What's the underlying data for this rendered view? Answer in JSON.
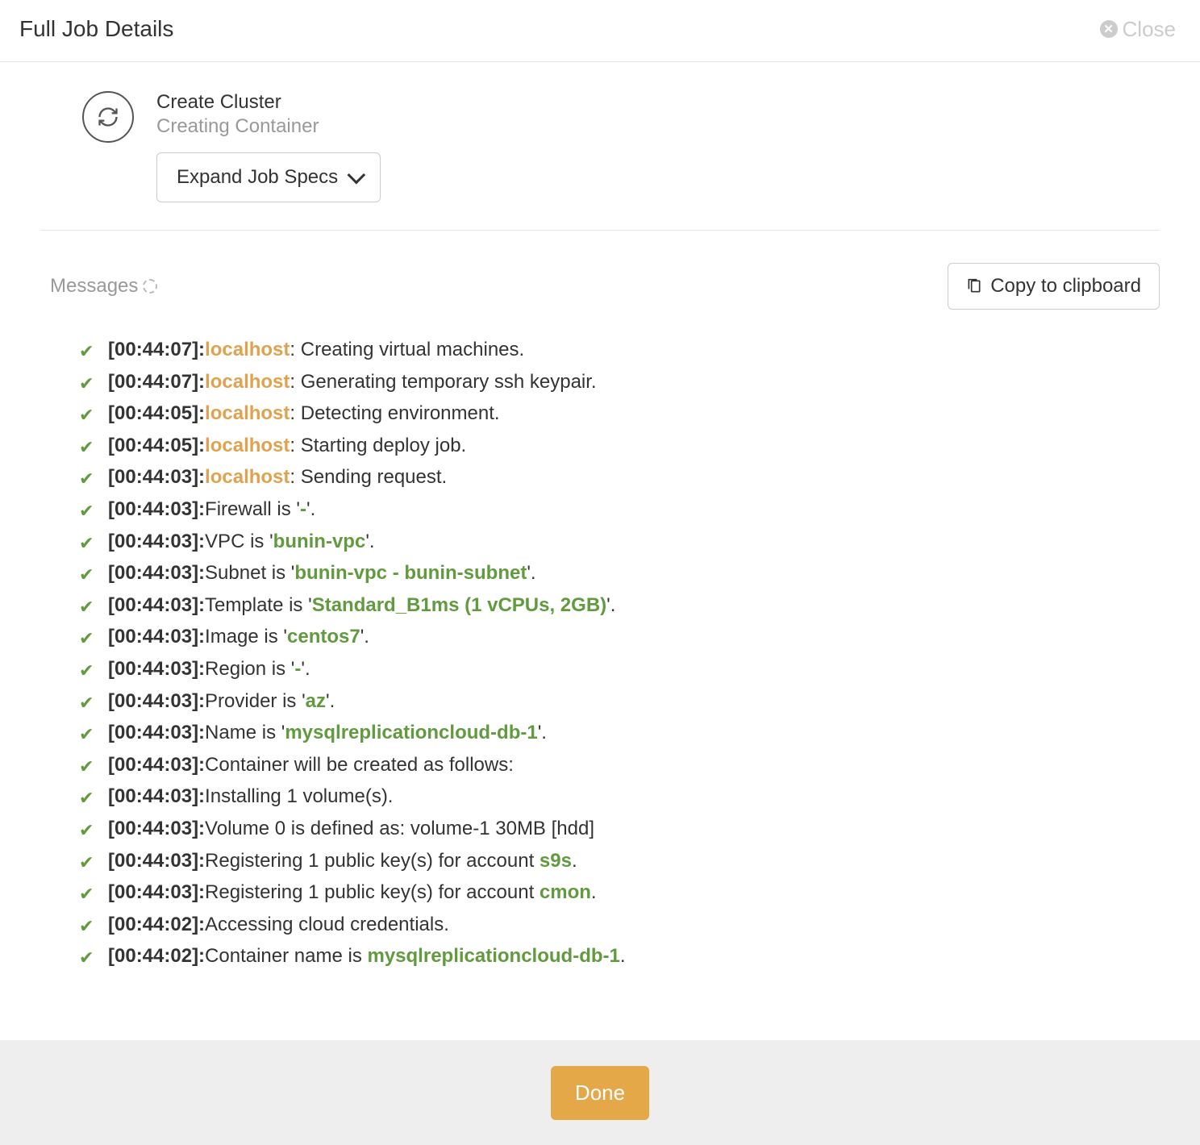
{
  "header": {
    "title": "Full Job Details",
    "close_label": "Close"
  },
  "job": {
    "name": "Create Cluster",
    "status": "Creating Container",
    "expand_label": "Expand Job Specs"
  },
  "messages_section": {
    "label": "Messages",
    "copy_label": "Copy to clipboard"
  },
  "footer": {
    "done_label": "Done"
  },
  "logs": [
    {
      "ts": "[00:44:07]:",
      "host": "localhost",
      "parts": [
        {
          "t": "plain",
          "v": ": Creating virtual machines."
        }
      ]
    },
    {
      "ts": "[00:44:07]:",
      "host": "localhost",
      "parts": [
        {
          "t": "plain",
          "v": ": Generating temporary ssh keypair."
        }
      ]
    },
    {
      "ts": "[00:44:05]:",
      "host": "localhost",
      "parts": [
        {
          "t": "plain",
          "v": ": Detecting environment."
        }
      ]
    },
    {
      "ts": "[00:44:05]:",
      "host": "localhost",
      "parts": [
        {
          "t": "plain",
          "v": ": Starting deploy job."
        }
      ]
    },
    {
      "ts": "[00:44:03]:",
      "host": "localhost",
      "parts": [
        {
          "t": "plain",
          "v": ": Sending request."
        }
      ]
    },
    {
      "ts": "[00:44:03]:",
      "parts": [
        {
          "t": "plain",
          "v": "Firewall is '"
        },
        {
          "t": "green",
          "v": "-"
        },
        {
          "t": "plain",
          "v": "'."
        }
      ]
    },
    {
      "ts": "[00:44:03]:",
      "parts": [
        {
          "t": "plain",
          "v": "VPC is '"
        },
        {
          "t": "green",
          "v": "bunin-vpc"
        },
        {
          "t": "plain",
          "v": "'."
        }
      ]
    },
    {
      "ts": "[00:44:03]:",
      "parts": [
        {
          "t": "plain",
          "v": "Subnet is '"
        },
        {
          "t": "green",
          "v": "bunin-vpc - bunin-subnet"
        },
        {
          "t": "plain",
          "v": "'."
        }
      ]
    },
    {
      "ts": "[00:44:03]:",
      "parts": [
        {
          "t": "plain",
          "v": "Template is '"
        },
        {
          "t": "green",
          "v": "Standard_B1ms (1 vCPUs, 2GB)"
        },
        {
          "t": "plain",
          "v": "'."
        }
      ]
    },
    {
      "ts": "[00:44:03]:",
      "parts": [
        {
          "t": "plain",
          "v": "Image is '"
        },
        {
          "t": "green",
          "v": "centos7"
        },
        {
          "t": "plain",
          "v": "'."
        }
      ]
    },
    {
      "ts": "[00:44:03]:",
      "parts": [
        {
          "t": "plain",
          "v": "Region is '"
        },
        {
          "t": "green",
          "v": "-"
        },
        {
          "t": "plain",
          "v": "'."
        }
      ]
    },
    {
      "ts": "[00:44:03]:",
      "parts": [
        {
          "t": "plain",
          "v": "Provider is '"
        },
        {
          "t": "green",
          "v": "az"
        },
        {
          "t": "plain",
          "v": "'."
        }
      ]
    },
    {
      "ts": "[00:44:03]:",
      "parts": [
        {
          "t": "plain",
          "v": "Name is '"
        },
        {
          "t": "green",
          "v": "mysqlreplicationcloud-db-1"
        },
        {
          "t": "plain",
          "v": "'."
        }
      ]
    },
    {
      "ts": "[00:44:03]:",
      "parts": [
        {
          "t": "plain",
          "v": "Container will be created as follows:"
        }
      ]
    },
    {
      "ts": "[00:44:03]:",
      "parts": [
        {
          "t": "plain",
          "v": "Installing 1 volume(s)."
        }
      ]
    },
    {
      "ts": "[00:44:03]:",
      "parts": [
        {
          "t": "plain",
          "v": "Volume 0 is defined as: volume-1 30MB [hdd]"
        }
      ]
    },
    {
      "ts": "[00:44:03]:",
      "parts": [
        {
          "t": "plain",
          "v": "Registering 1 public key(s) for account "
        },
        {
          "t": "green",
          "v": "s9s"
        },
        {
          "t": "plain",
          "v": "."
        }
      ]
    },
    {
      "ts": "[00:44:03]:",
      "parts": [
        {
          "t": "plain",
          "v": "Registering 1 public key(s) for account "
        },
        {
          "t": "green",
          "v": "cmon"
        },
        {
          "t": "plain",
          "v": "."
        }
      ]
    },
    {
      "ts": "[00:44:02]:",
      "parts": [
        {
          "t": "plain",
          "v": "Accessing cloud credentials."
        }
      ]
    },
    {
      "ts": "[00:44:02]:",
      "parts": [
        {
          "t": "plain",
          "v": "Container name is "
        },
        {
          "t": "green",
          "v": "mysqlreplicationcloud-db-1"
        },
        {
          "t": "plain",
          "v": "."
        }
      ]
    }
  ]
}
